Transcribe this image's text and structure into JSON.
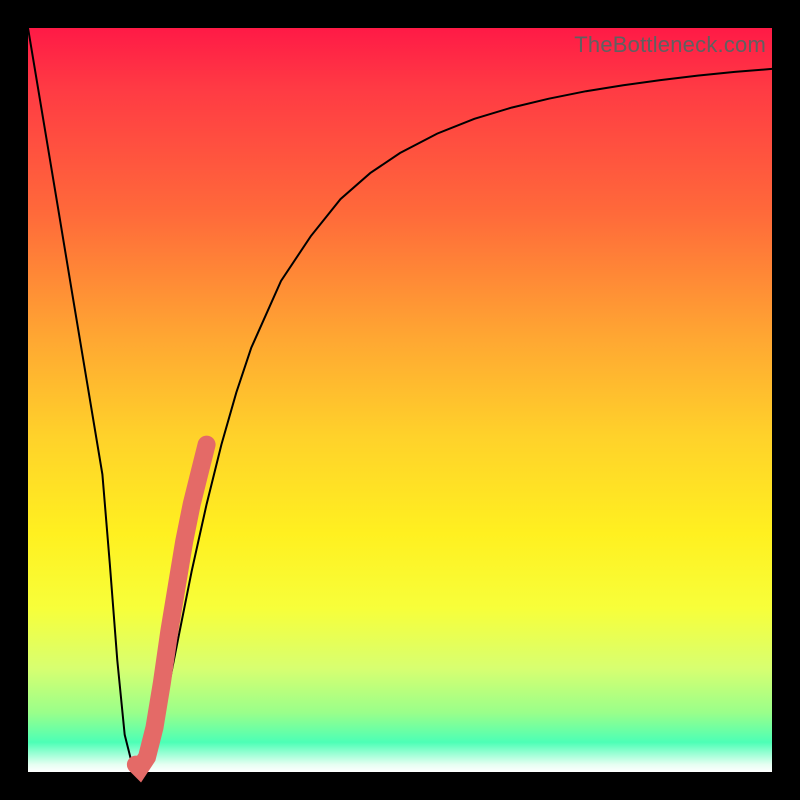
{
  "watermark": "TheBottleneck.com",
  "colors": {
    "frame": "#000000",
    "curve": "#000000",
    "highlight": "#e46a67",
    "gradient_top": "#ff1a46",
    "gradient_mid": "#fff020",
    "gradient_bottom": "#4cffb6"
  },
  "chart_data": {
    "type": "line",
    "title": "",
    "xlabel": "",
    "ylabel": "",
    "xlim": [
      0,
      100
    ],
    "ylim": [
      0,
      100
    ],
    "grid": false,
    "x": [
      0,
      2,
      4,
      6,
      8,
      10,
      11,
      12,
      13,
      14,
      15,
      16,
      18,
      20,
      22,
      24,
      26,
      28,
      30,
      34,
      38,
      42,
      46,
      50,
      55,
      60,
      65,
      70,
      75,
      80,
      85,
      90,
      95,
      100
    ],
    "values": [
      100,
      88,
      76,
      64,
      52,
      40,
      28,
      15,
      5,
      1,
      0.3,
      1,
      7,
      17,
      27,
      36,
      44,
      51,
      57,
      66,
      72,
      77,
      80.5,
      83.2,
      85.8,
      87.8,
      89.3,
      90.5,
      91.5,
      92.3,
      93.0,
      93.6,
      94.1,
      94.5
    ],
    "note": "x and values are percentages of the plotted area (0=bottom/left, 100=top/right). Curve is a sharp V minimum near x≈14 then logarithmic rise.",
    "series": [
      {
        "name": "bottleneck-curve",
        "style": "thin-black",
        "x_ref": "x",
        "y_ref": "values"
      },
      {
        "name": "highlight-segment",
        "style": "thick-salmon",
        "x": [
          14.5,
          15,
          16,
          17,
          18,
          19,
          20,
          21,
          22,
          23,
          24
        ],
        "values": [
          1,
          0.5,
          2,
          6,
          12,
          19,
          25,
          31,
          36,
          40,
          44
        ]
      }
    ]
  }
}
